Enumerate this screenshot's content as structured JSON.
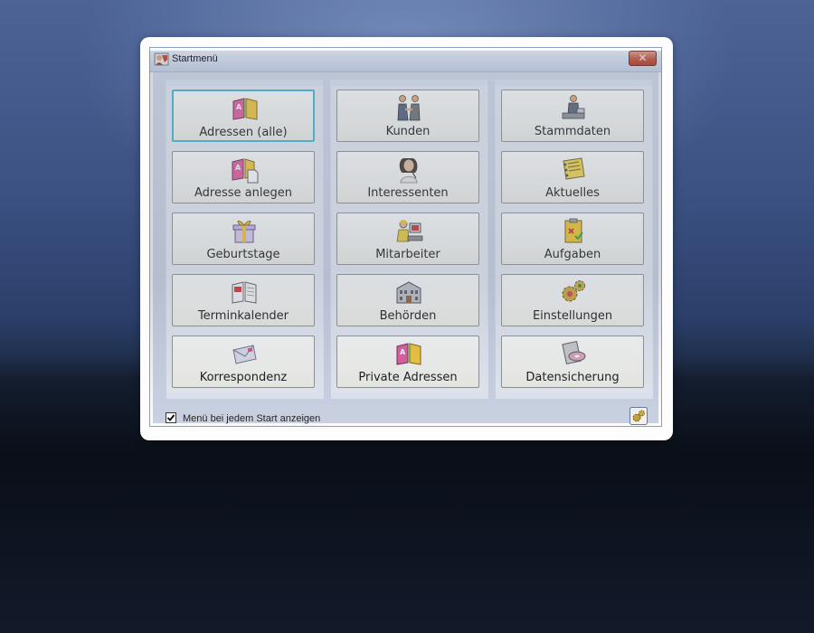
{
  "window": {
    "title": "Startmenü",
    "close_glyph": "✕"
  },
  "columns": [
    {
      "buttons": [
        {
          "label": "Adressen (alle)",
          "icon": "address-book-icon",
          "focused": true
        },
        {
          "label": "Adresse anlegen",
          "icon": "new-address-icon"
        },
        {
          "label": "Geburtstage",
          "icon": "gift-icon"
        },
        {
          "label": "Terminkalender",
          "icon": "calendar-icon"
        },
        {
          "label": "Korrespondenz",
          "icon": "envelope-icon"
        }
      ]
    },
    {
      "buttons": [
        {
          "label": "Kunden",
          "icon": "customers-icon"
        },
        {
          "label": "Interessenten",
          "icon": "prospect-icon"
        },
        {
          "label": "Mitarbeiter",
          "icon": "employee-icon"
        },
        {
          "label": "Behörden",
          "icon": "building-icon"
        },
        {
          "label": "Private Adressen",
          "icon": "private-address-book-icon"
        }
      ]
    },
    {
      "buttons": [
        {
          "label": "Stammdaten",
          "icon": "master-data-icon"
        },
        {
          "label": "Aktuelles",
          "icon": "news-icon"
        },
        {
          "label": "Aufgaben",
          "icon": "tasks-icon"
        },
        {
          "label": "Einstellungen",
          "icon": "gears-icon"
        },
        {
          "label": "Datensicherung",
          "icon": "backup-icon"
        }
      ]
    }
  ],
  "footer": {
    "show_on_start_label": "Menü bei jedem Start anzeigen",
    "show_on_start_checked": true,
    "settings_icon": "gears-icon"
  }
}
